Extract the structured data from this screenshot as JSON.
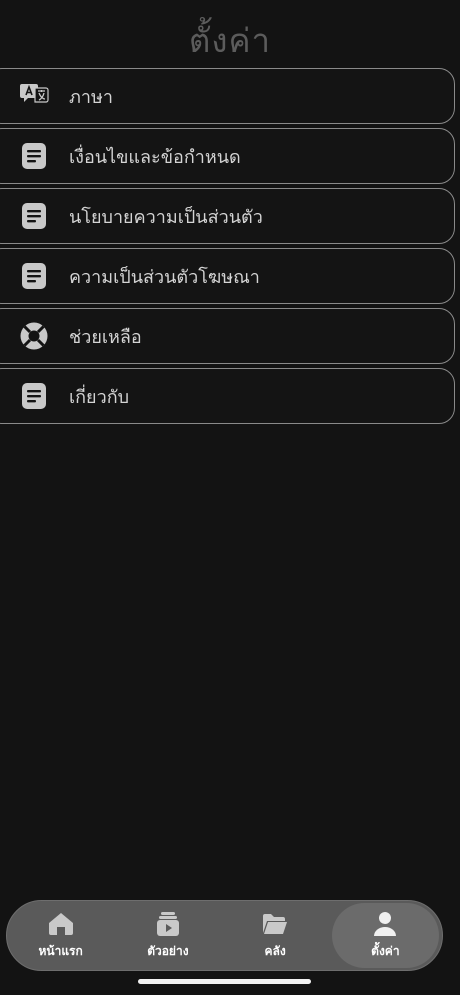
{
  "header": {
    "title": "ตั้งค่า"
  },
  "menu": {
    "items": [
      {
        "label": "ภาษา",
        "icon": "translate-icon"
      },
      {
        "label": "เงื่อนไขและข้อกำหนด",
        "icon": "document-icon"
      },
      {
        "label": "นโยบายความเป็นส่วนตัว",
        "icon": "document-icon"
      },
      {
        "label": "ความเป็นส่วนตัวโฆษณา",
        "icon": "document-icon"
      },
      {
        "label": "ช่วยเหลือ",
        "icon": "lifebuoy-icon"
      },
      {
        "label": "เกี่ยวกับ",
        "icon": "document-icon"
      }
    ]
  },
  "tabbar": {
    "tabs": [
      {
        "label": "หน้าแรก",
        "icon": "home-icon"
      },
      {
        "label": "ตัวอย่าง",
        "icon": "video-stack-icon"
      },
      {
        "label": "คลัง",
        "icon": "folder-icon"
      },
      {
        "label": "ตั้งค่า",
        "icon": "person-icon",
        "active": true
      }
    ]
  },
  "colors": {
    "background": "#131313",
    "tabbar": "#5a5a5a",
    "active_tab": "#6b6b6b",
    "icon": "#c9c9c9"
  }
}
